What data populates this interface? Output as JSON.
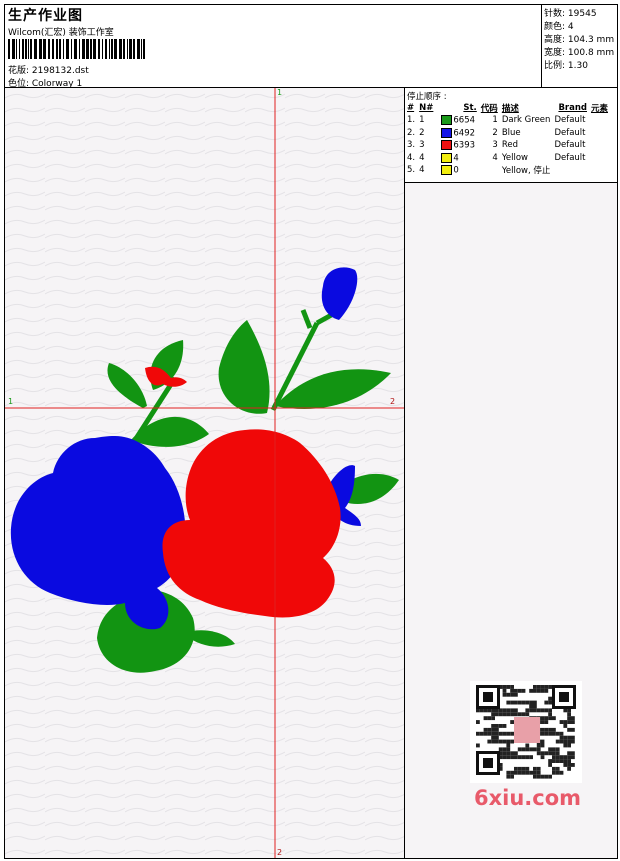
{
  "header": {
    "title": "生产作业图",
    "subtitle": "Wilcom(汇宏) 装饰工作室",
    "design_label": "花版: 2198132.dst",
    "colorway_label": "色位: Colorway 1"
  },
  "stats": [
    {
      "label": "针数:",
      "value": "19545"
    },
    {
      "label": "颜色:",
      "value": "4"
    },
    {
      "label": "高度:",
      "value": "104.3 mm"
    },
    {
      "label": "宽度:",
      "value": "100.8 mm"
    },
    {
      "label": "比例:",
      "value": "1.30"
    }
  ],
  "stop_sequence": {
    "heading": "停止顺序 :",
    "columns": [
      "#",
      "N#",
      "St.",
      "代码",
      "描述",
      "Brand",
      "元素"
    ],
    "rows": [
      {
        "idx": "1.",
        "n": "1",
        "color": "#1a9a1a",
        "code": "6654",
        "stops": "1",
        "desc": "Dark Green",
        "brand": "Default"
      },
      {
        "idx": "2.",
        "n": "2",
        "color": "#1414e8",
        "code": "6492",
        "stops": "2",
        "desc": "Blue",
        "brand": "Default"
      },
      {
        "idx": "3.",
        "n": "3",
        "color": "#ee1111",
        "code": "6393",
        "stops": "3",
        "desc": "Red",
        "brand": "Default"
      },
      {
        "idx": "4.",
        "n": "4",
        "color": "#f2ee10",
        "code": "4",
        "stops": "4",
        "desc": "Yellow",
        "brand": "Default"
      },
      {
        "idx": "5.",
        "n": "4",
        "color": "#f2ee10",
        "code": "0",
        "stops": "",
        "desc": "Yellow, 停止",
        "brand": ""
      }
    ]
  },
  "axes": {
    "top": "1",
    "bottom": "2",
    "left": "1",
    "right": "2"
  },
  "colors": {
    "green": "#129412",
    "blue": "#0a0ae0",
    "red": "#f00808",
    "guide": "#e02020",
    "background": "#f6f4f6"
  },
  "watermark": "6xiu.com"
}
